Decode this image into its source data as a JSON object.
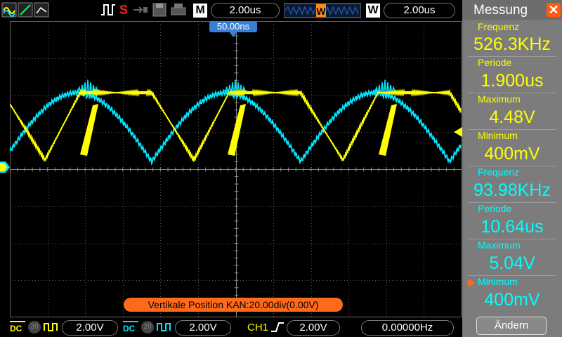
{
  "toolbar": {
    "mode_label": "M",
    "timebase": "2.00us",
    "window_label": "W",
    "window_timebase": "2.00us",
    "stop_label": "S"
  },
  "screen": {
    "trigger_time": "50.00ns",
    "notice": "Vertikale  Position  KAN:20.00div(0.00V)"
  },
  "panel": {
    "title": "Messung",
    "ch1": [
      {
        "label": "Frequenz",
        "value": "526.3KHz"
      },
      {
        "label": "Periode",
        "value": "1.900us"
      },
      {
        "label": "Maximum",
        "value": "4.48V"
      },
      {
        "label": "Minimum",
        "value": "400mV"
      }
    ],
    "ch2": [
      {
        "label": "Frequenz",
        "value": "93.98KHz"
      },
      {
        "label": "Periode",
        "value": "10.64us"
      },
      {
        "label": "Maximum",
        "value": "5.04V"
      },
      {
        "label": "Minimum",
        "value": "400mV"
      }
    ],
    "change_button": "Ändern"
  },
  "bottom": {
    "ch1_coupling": "DC",
    "ch1_bw": "20",
    "ch1_scale": "2.00V",
    "ch2_coupling": "DC",
    "ch2_bw": "20",
    "ch2_scale": "2.00V",
    "trigger_source": "CH1",
    "trigger_level": "2.00V",
    "frequency": "0.00000Hz"
  },
  "colors": {
    "ch1": "#ffff00",
    "ch2": "#00e5ff",
    "accent": "#ff6a1a",
    "trigger_marker": "#3a7fd5"
  }
}
